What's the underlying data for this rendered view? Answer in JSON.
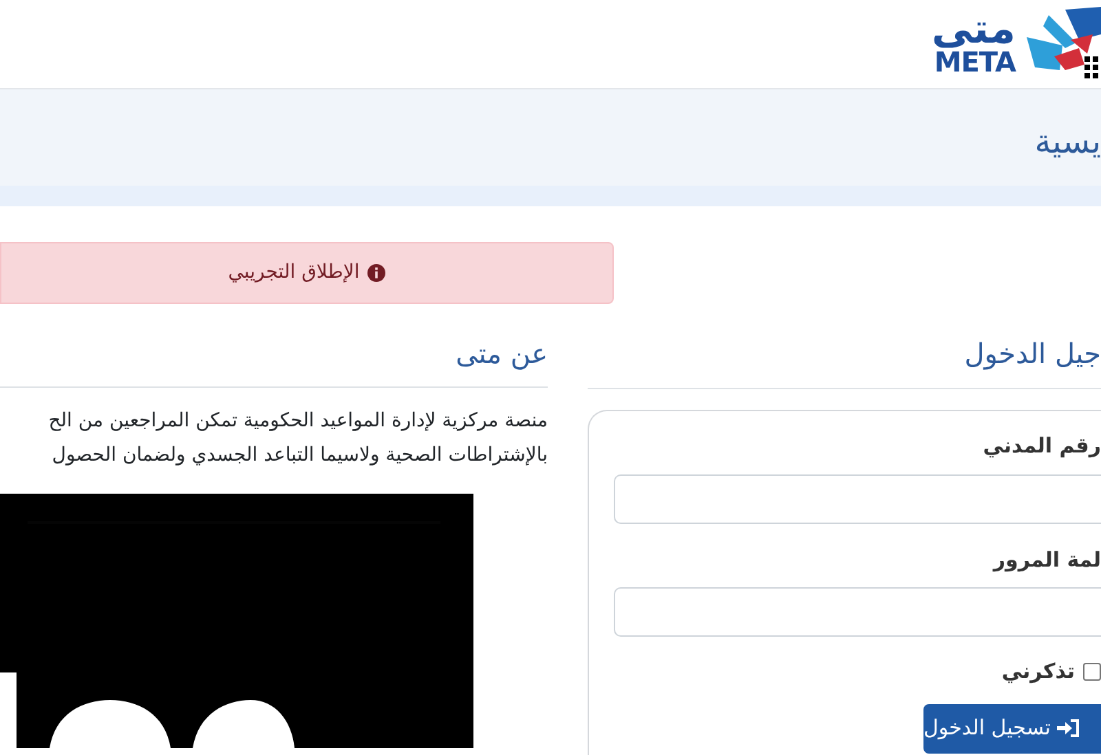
{
  "logo": {
    "arabic": "متى",
    "latin": "META"
  },
  "breadcrumb": {
    "title": "يسية"
  },
  "alert": {
    "text": "الإطلاق التجريبي"
  },
  "about": {
    "heading": "عن متى",
    "lines": [
      "منصة مركزية لإدارة المواعيد الحكومية تمكن المراجعين من الح",
      "بالإشتراطات الصحية ولاسيما التباعد الجسدي ولضمان الحصول"
    ]
  },
  "login": {
    "heading": "جيل الدخول",
    "fields": [
      {
        "label": "رقم المدني"
      },
      {
        "label": "لمة المرور"
      }
    ],
    "remember": {
      "label": "تذكرني",
      "checked": false
    },
    "button": "تسجيل الدخول"
  }
}
